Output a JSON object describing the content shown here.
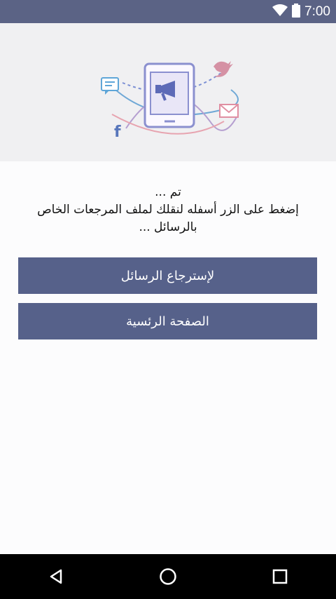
{
  "status_bar": {
    "time": "7:00",
    "icons": [
      "wifi-icon",
      "battery-icon"
    ]
  },
  "hero": {
    "illustration": "phone-megaphone-social-illustration",
    "icons": [
      "chat-bubble-icon",
      "twitter-bird-icon",
      "facebook-icon",
      "envelope-icon",
      "megaphone-icon"
    ]
  },
  "message": {
    "line1": "تم ...",
    "line2": "إضغط على الزر أسفله لنقلك لملف المرجعات الخاص",
    "line3": "بالرسائل ..."
  },
  "buttons": {
    "messages_label": "لإسترجاع الرسائل",
    "home_label": "الصفحة الرئسية"
  },
  "colors": {
    "status_bar": "#5b6385",
    "button": "#56618a",
    "hero_bg": "#f0f0f2"
  },
  "nav": {
    "icons": [
      "back-icon",
      "home-icon",
      "recents-icon"
    ]
  }
}
